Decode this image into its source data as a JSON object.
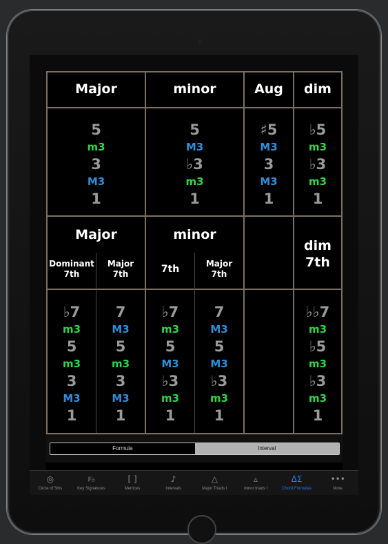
{
  "triads": {
    "headers": [
      "Major",
      "minor",
      "Aug",
      "dim"
    ],
    "columns": [
      [
        {
          "t": "5",
          "c": "deg"
        },
        {
          "t": "m3",
          "c": "m3"
        },
        {
          "t": "3",
          "c": "deg"
        },
        {
          "t": "M3",
          "c": "M3"
        },
        {
          "t": "1",
          "c": "deg"
        }
      ],
      [
        {
          "t": "5",
          "c": "deg"
        },
        {
          "t": "M3",
          "c": "M3"
        },
        {
          "t": "♭3",
          "c": "deg"
        },
        {
          "t": "m3",
          "c": "m3"
        },
        {
          "t": "1",
          "c": "deg"
        }
      ],
      [
        {
          "t": "♯5",
          "c": "deg"
        },
        {
          "t": "M3",
          "c": "M3"
        },
        {
          "t": "3",
          "c": "deg"
        },
        {
          "t": "M3",
          "c": "M3"
        },
        {
          "t": "1",
          "c": "deg"
        }
      ],
      [
        {
          "t": "♭5",
          "c": "deg"
        },
        {
          "t": "m3",
          "c": "m3"
        },
        {
          "t": "♭3",
          "c": "deg"
        },
        {
          "t": "m3",
          "c": "m3"
        },
        {
          "t": "1",
          "c": "deg"
        }
      ]
    ]
  },
  "sevenths": {
    "group_major": "Major",
    "group_minor": "minor",
    "dim7_line1": "dim",
    "dim7_line2": "7th",
    "sub_dominant_1": "Dominant",
    "sub_dominant_2": "7th",
    "sub_major_1": "Major",
    "sub_major_2": "7th",
    "sub_minor7": "7th",
    "sub_minor_major_1": "Major",
    "sub_minor_major_2": "7th",
    "columns": [
      [
        {
          "t": "♭7",
          "c": "deg"
        },
        {
          "t": "m3",
          "c": "m3"
        },
        {
          "t": "5",
          "c": "deg"
        },
        {
          "t": "m3",
          "c": "m3"
        },
        {
          "t": "3",
          "c": "deg"
        },
        {
          "t": "M3",
          "c": "M3"
        },
        {
          "t": "1",
          "c": "deg"
        }
      ],
      [
        {
          "t": "7",
          "c": "deg"
        },
        {
          "t": "M3",
          "c": "M3"
        },
        {
          "t": "5",
          "c": "deg"
        },
        {
          "t": "m3",
          "c": "m3"
        },
        {
          "t": "3",
          "c": "deg"
        },
        {
          "t": "M3",
          "c": "M3"
        },
        {
          "t": "1",
          "c": "deg"
        }
      ],
      [
        {
          "t": "♭7",
          "c": "deg"
        },
        {
          "t": "m3",
          "c": "m3"
        },
        {
          "t": "5",
          "c": "deg"
        },
        {
          "t": "M3",
          "c": "M3"
        },
        {
          "t": "♭3",
          "c": "deg"
        },
        {
          "t": "m3",
          "c": "m3"
        },
        {
          "t": "1",
          "c": "deg"
        }
      ],
      [
        {
          "t": "7",
          "c": "deg"
        },
        {
          "t": "M3",
          "c": "M3"
        },
        {
          "t": "5",
          "c": "deg"
        },
        {
          "t": "M3",
          "c": "M3"
        },
        {
          "t": "♭3",
          "c": "deg"
        },
        {
          "t": "m3",
          "c": "m3"
        },
        {
          "t": "1",
          "c": "deg"
        }
      ],
      [
        {
          "t": "♭♭7",
          "c": "deg"
        },
        {
          "t": "m3",
          "c": "m3"
        },
        {
          "t": "♭5",
          "c": "deg"
        },
        {
          "t": "m3",
          "c": "m3"
        },
        {
          "t": "♭3",
          "c": "deg"
        },
        {
          "t": "m3",
          "c": "m3"
        },
        {
          "t": "1",
          "c": "deg"
        }
      ]
    ]
  },
  "segmented": {
    "options": [
      "Formula",
      "Interval"
    ],
    "selected": "Interval"
  },
  "tabbar": {
    "items": [
      {
        "label": "Circle of 5ths",
        "icon": "circle-of-fifths-icon",
        "glyph": "◎"
      },
      {
        "label": "Key Signatures",
        "icon": "key-signature-icon",
        "glyph": "♯♭"
      },
      {
        "label": "Metrices",
        "icon": "brackets-icon",
        "glyph": "[ ]"
      },
      {
        "label": "Intervals",
        "icon": "note-icon",
        "glyph": "♪"
      },
      {
        "label": "Major Triads I",
        "icon": "triangle-icon",
        "glyph": "△"
      },
      {
        "label": "minor triads I",
        "icon": "small-triangle-icon",
        "glyph": "▵"
      },
      {
        "label": "Chord Formulas",
        "icon": "delta-sigma-icon",
        "glyph": "ΔΣ"
      },
      {
        "label": "More",
        "icon": "more-icon",
        "glyph": "•••"
      }
    ],
    "active_index": 6
  },
  "colors": {
    "minor_third": "#33d34a",
    "major_third": "#2f8fd8",
    "degree": "#9a9a9a",
    "active_tab": "#1e7ef0"
  }
}
